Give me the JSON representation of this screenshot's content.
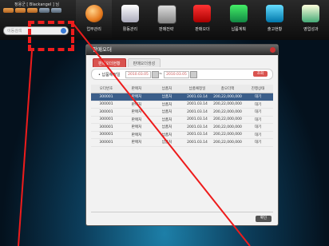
{
  "user": {
    "name": "정용군 [ Blackangel ] 님",
    "search_placeholder": "이동검색"
  },
  "menu": [
    {
      "label": "업무관리",
      "icon": "orange"
    },
    {
      "label": "활동관리",
      "icon": "white"
    },
    {
      "label": "판매전략",
      "icon": "calc"
    },
    {
      "label": "판매오더",
      "icon": "red"
    },
    {
      "label": "납품계획",
      "icon": "green"
    },
    {
      "label": "출고현황",
      "icon": "cyan"
    },
    {
      "label": "영업성과",
      "icon": "stack"
    }
  ],
  "dialog": {
    "title": "판매오더",
    "tabs": [
      "판매오더현황",
      "판매오더생성"
    ],
    "filter_label": "• 납품예정일",
    "date_from": "2010.03.05",
    "date_to": "2010.03.05",
    "search_label": "조회",
    "columns": [
      "오더번호",
      "판매처",
      "납품처",
      "납품예정일",
      "총오더액",
      "진행상태"
    ],
    "rows": [
      [
        "300001",
        "판매처",
        "납품처",
        "2001.03.14",
        "200,22,000,000",
        "대기"
      ],
      [
        "300001",
        "판매처",
        "납품처",
        "2001.03.14",
        "200,22,000,000",
        "대기"
      ],
      [
        "300001",
        "판매처",
        "납품처",
        "2001.03.14",
        "200,22,000,000",
        "대기"
      ],
      [
        "300001",
        "판매처",
        "납품처",
        "2001.03.14",
        "200,22,000,000",
        "대기"
      ],
      [
        "300001",
        "판매처",
        "납품처",
        "2001.03.14",
        "200,22,000,000",
        "대기"
      ],
      [
        "300001",
        "판매처",
        "납품처",
        "2001.03.14",
        "200,22,000,000",
        "대기"
      ],
      [
        "300001",
        "판매처",
        "납품처",
        "2001.03.14",
        "200,22,000,000",
        "대기"
      ]
    ],
    "confirm_label": "확인"
  },
  "colors": {
    "accent": "#d9534f",
    "annotation": "#ee1c1c"
  }
}
